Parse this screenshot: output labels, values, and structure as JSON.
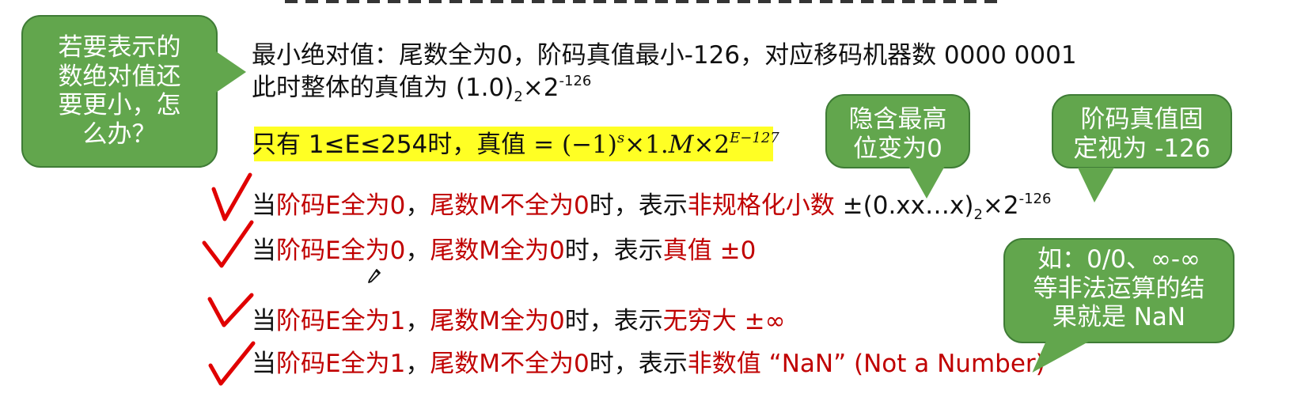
{
  "callouts": {
    "smaller": "若要表示的\n数绝对值还\n要更小，怎\n么办？",
    "hidden": "隐含最高\n位变为0",
    "exponent": "阶码真值固\n定视为 -126",
    "nan": "如：0/0、∞-∞\n等非法运算的结\n果就是 NaN"
  },
  "lines": {
    "min_abs": {
      "text": "最小绝对值：尾数全为0，阶码真值最小-126，对应移码机器数 0000 0001"
    },
    "true_value": {
      "prefix": "此时整体的真值为 (1.0)",
      "subscript": "2",
      "middle": "×2",
      "superscript": "-126"
    },
    "highlight": {
      "condition": "只有 1≤E≤254时，真值",
      "formula_part1": " = (−1)",
      "formula_sup_s": "s",
      "formula_part2": "×1.",
      "formula_M": "M",
      "formula_part3": "×2",
      "formula_exp": "E−127"
    },
    "line1": {
      "prefix": "当",
      "red1": "阶码E全为0",
      "sep": "，",
      "red2": "尾数M不全为0",
      "mid": "时，表示",
      "red3": "非规格化小数",
      "value_prefix": " ±(0.xx…x)",
      "value_sub": "2",
      "value_mid": "×2",
      "value_sup": "-126"
    },
    "line2": {
      "prefix": "当",
      "red1": "阶码E全为0",
      "sep": "，",
      "red2": "尾数M全为0",
      "mid": "时，表示",
      "red3": "真值",
      "value": " ±0"
    },
    "line3": {
      "prefix": "当",
      "red1": "阶码E全为1",
      "sep": "，",
      "red2": "尾数M全为0",
      "mid": "时，表示",
      "red3": "无穷大",
      "value": " ±∞"
    },
    "line4": {
      "prefix": "当",
      "red1": "阶码E全为1",
      "sep": "，",
      "red2": "尾数M不全为0",
      "mid": "时，表示",
      "red3": "非数值 “NaN” (Not a Number)"
    }
  },
  "colors": {
    "callout": "#62a64d",
    "highlight": "#ffff24",
    "accent_red": "#c00000"
  },
  "icons": {
    "check": "check-icon",
    "pencil": "pencil-icon"
  }
}
